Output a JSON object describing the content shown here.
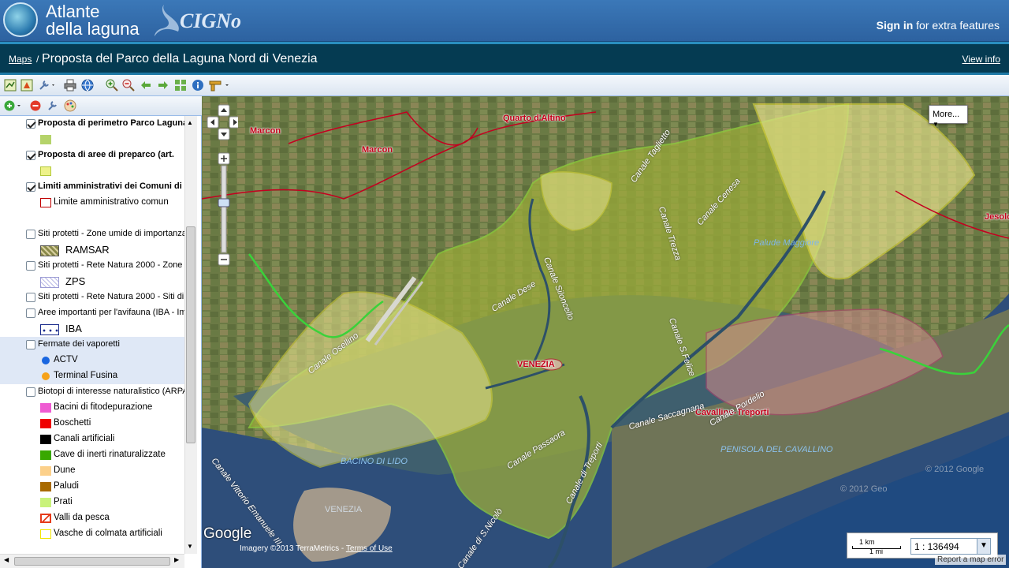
{
  "header": {
    "logo_line1": "Atlante",
    "logo_line2": "della laguna",
    "logo_brand": "CIGNo",
    "signin_link": "Sign in",
    "signin_rest": " for extra features"
  },
  "titlebar": {
    "crumb_maps": "Maps",
    "crumb_sep": "/",
    "map_title": "Proposta del Parco della Laguna Nord di Venezia",
    "view_info": "View info"
  },
  "toolbar": {
    "icons": [
      "map-properties-icon",
      "save-map-icon",
      "tools-dropdown-icon",
      "print-icon",
      "globe-icon",
      "zoom-in-icon",
      "zoom-out-icon",
      "back-icon",
      "forward-icon",
      "zoom-extent-icon",
      "info-icon",
      "measure-dropdown-icon"
    ]
  },
  "side_toolbar": {
    "icons": [
      "add-layer-icon",
      "remove-layer-icon",
      "layer-properties-icon",
      "style-icon"
    ]
  },
  "legend": {
    "layers": [
      {
        "label": "Proposta di perimetro Parco Laguna",
        "checked": true,
        "bold": true,
        "symbols": [
          {
            "label": "",
            "type": "fill",
            "color": "#b5d36a",
            "border": "#b5d36a"
          }
        ]
      },
      {
        "label": "Proposta di aree di preparco (art.",
        "checked": true,
        "bold": true,
        "symbols": [
          {
            "label": "",
            "type": "fill",
            "color": "#eef28a",
            "border": "#b3c83a"
          }
        ]
      },
      {
        "label": "Limiti amministrativi dei Comuni di",
        "checked": true,
        "bold": true,
        "symbols": [
          {
            "label": "Limite amministrativo comun",
            "type": "outline",
            "color": "#ffffff",
            "border": "#c00000"
          }
        ]
      },
      {
        "label": "Siti protetti - Zone umide di importanza",
        "checked": false,
        "bold": false,
        "symbols": [
          {
            "label": "RAMSAR",
            "type": "hatch",
            "color": "#8a8a4a",
            "border": "#555"
          }
        ]
      },
      {
        "label": "Siti protetti - Rete Natura 2000 - Zone di",
        "checked": false,
        "bold": false,
        "symbols": [
          {
            "label": "ZPS",
            "type": "hatch-light",
            "color": "#b9b9e6",
            "border": "#9b9bd4"
          }
        ]
      },
      {
        "label": "Siti protetti - Rete Natura 2000 - Siti di I",
        "checked": false,
        "bold": false,
        "symbols": []
      },
      {
        "label": "Aree importanti per l'avifauna (IBA - Im",
        "checked": false,
        "bold": false,
        "symbols": [
          {
            "label": "IBA",
            "type": "dots",
            "color": "#ffffff",
            "border": "#1a2c8c"
          }
        ]
      },
      {
        "label": "Fermate dei vaporetti",
        "checked": false,
        "bold": false,
        "highlight": true,
        "symbols": [
          {
            "label": "ACTV",
            "type": "circle",
            "color": "#1a66e0",
            "border": "#1a66e0"
          },
          {
            "label": "Terminal Fusina",
            "type": "circle",
            "color": "#f6a21a",
            "border": "#f6a21a"
          }
        ]
      },
      {
        "label": "Biotopi di interesse naturalistico (ARPA",
        "checked": false,
        "bold": false,
        "symbols": [
          {
            "label": "Bacini di fitodepurazione",
            "type": "fill",
            "color": "#ef5bd2",
            "border": "#ef5bd2"
          },
          {
            "label": "Boschetti",
            "type": "fill",
            "color": "#ef0000",
            "border": "#ef0000"
          },
          {
            "label": "Canali artificiali",
            "type": "fill",
            "color": "#000000",
            "border": "#000000"
          },
          {
            "label": "Cave di inerti rinaturalizzate",
            "type": "fill",
            "color": "#38a800",
            "border": "#38a800"
          },
          {
            "label": "Dune",
            "type": "fill",
            "color": "#fcd08a",
            "border": "#fcd08a"
          },
          {
            "label": "Paludi",
            "type": "fill",
            "color": "#a86a00",
            "border": "#a86a00"
          },
          {
            "label": "Prati",
            "type": "fill",
            "color": "#c9f27a",
            "border": "#c9f27a"
          },
          {
            "label": "Valli da pesca",
            "type": "hatch-red",
            "color": "#ffffff",
            "border": "#e53b1a"
          },
          {
            "label": "Vasche di colmata artificiali",
            "type": "outline",
            "color": "#ffffff",
            "border": "#f2e600"
          }
        ]
      }
    ]
  },
  "map": {
    "more_button": "More...",
    "labels_red": [
      "Marcon",
      "Marcon",
      "Quarto d'Altino",
      "VENEZIA",
      "Cavallino-Treporti",
      "Jesolo"
    ],
    "labels_white": [
      "Canale Osellino",
      "Canale Dese",
      "Canale Siloncello",
      "Canale Taglietto",
      "Canale Cenesa",
      "Canale Trezza",
      "Canale Passaora",
      "Canale di Treporti",
      "Canale S.Felice",
      "Canale Saccagnana",
      "Canale Pordelio",
      "Canale di S.Nicolò",
      "Canale Vittorio Emanuele III"
    ],
    "labels_blue": [
      "Palude Maggiore",
      "BACINO DI LIDO",
      "PENISOLA DEL CAVALLINO",
      "VENEZIA"
    ],
    "google_logo": "Google",
    "attribution_prefix": "Imagery ©2013 TerraMetrics - ",
    "attribution_link": "Terms of Use",
    "copyright1": "© 2012 Google",
    "copyright2": "© 2012 Geo",
    "report_error": "Report a map error",
    "scale_km": "1 km",
    "scale_mi": "1 mi",
    "scale_value": "1 : 136494"
  }
}
